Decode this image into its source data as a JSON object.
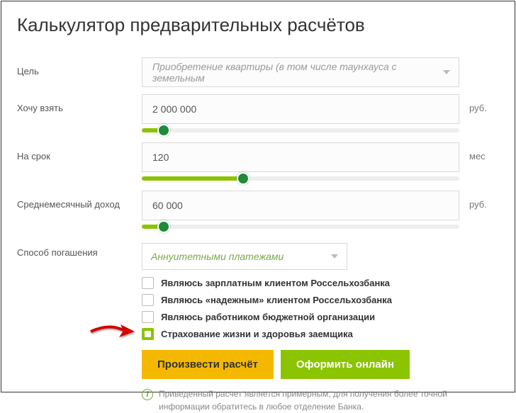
{
  "title": "Калькулятор предварительных расчётов",
  "labels": {
    "goal": "Цель",
    "amount": "Хочу взять",
    "term": "На срок",
    "income": "Среднемесячный доход",
    "method": "Способ погашения"
  },
  "goal_selected": "Приобретение квартиры (в том числе таунхауса с земельным",
  "amount_value": "2 000 000",
  "term_value": "120",
  "income_value": "60 000",
  "units": {
    "rub": "руб.",
    "mes": "мес"
  },
  "method_selected": "Аннуитетными платежами",
  "checks": {
    "c1": {
      "label": "Являюсь зарплатным клиентом Россельхозбанка",
      "checked": false
    },
    "c2": {
      "label": "Являюсь «надежным» клиентом Россельхозбанка",
      "checked": false
    },
    "c3": {
      "label": "Являюсь работником бюджетной организации",
      "checked": false
    },
    "c4": {
      "label": "Страхование жизни и здоровья заемщика",
      "checked": true
    }
  },
  "buttons": {
    "calculate": "Произвести расчёт",
    "apply": "Оформить онлайн"
  },
  "note": "Приведенный расчет является примерным, для получения более точной информации обратитесь в любое отделение Банка.",
  "slider_pos": {
    "amount": 7,
    "term": 32,
    "income": 7
  }
}
